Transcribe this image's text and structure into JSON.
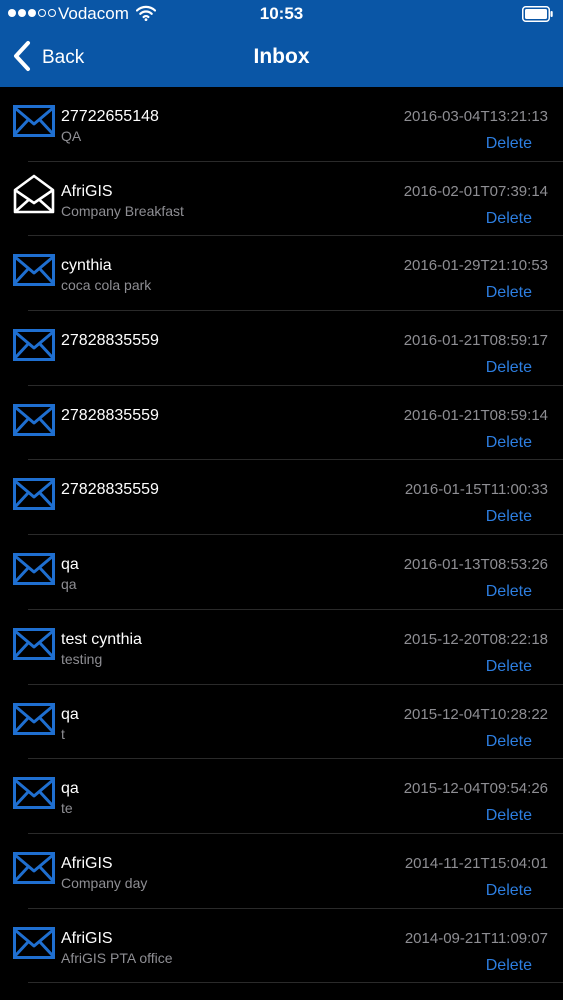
{
  "status_bar": {
    "carrier": "Vodacom",
    "time": "10:53",
    "signal_bars_filled": 3,
    "signal_bars_total": 5
  },
  "nav": {
    "back_label": "Back",
    "title": "Inbox"
  },
  "colors": {
    "nav_background": "#0a56a6",
    "accent": "#2d7ee0",
    "unread_icon": "#1f6fd0",
    "read_icon": "#ffffff"
  },
  "messages": [
    {
      "from": "27722655148",
      "subject": "QA",
      "timestamp": "2016-03-04T13:21:13",
      "delete_label": "Delete",
      "icon": "envelope-closed-icon"
    },
    {
      "from": "AfriGIS",
      "subject": "Company Breakfast",
      "timestamp": "2016-02-01T07:39:14",
      "delete_label": "Delete",
      "icon": "envelope-open-icon"
    },
    {
      "from": "cynthia",
      "subject": "coca cola park",
      "timestamp": "2016-01-29T21:10:53",
      "delete_label": "Delete",
      "icon": "envelope-closed-icon"
    },
    {
      "from": "27828835559",
      "subject": "",
      "timestamp": "2016-01-21T08:59:17",
      "delete_label": "Delete",
      "icon": "envelope-closed-icon"
    },
    {
      "from": "27828835559",
      "subject": "",
      "timestamp": "2016-01-21T08:59:14",
      "delete_label": "Delete",
      "icon": "envelope-closed-icon"
    },
    {
      "from": "27828835559",
      "subject": "",
      "timestamp": "2016-01-15T11:00:33",
      "delete_label": "Delete",
      "icon": "envelope-closed-icon"
    },
    {
      "from": "qa",
      "subject": "qa",
      "timestamp": "2016-01-13T08:53:26",
      "delete_label": "Delete",
      "icon": "envelope-closed-icon"
    },
    {
      "from": "test cynthia",
      "subject": "testing",
      "timestamp": "2015-12-20T08:22:18",
      "delete_label": "Delete",
      "icon": "envelope-closed-icon"
    },
    {
      "from": "qa",
      "subject": "t",
      "timestamp": "2015-12-04T10:28:22",
      "delete_label": "Delete",
      "icon": "envelope-closed-icon"
    },
    {
      "from": "qa",
      "subject": "te",
      "timestamp": "2015-12-04T09:54:26",
      "delete_label": "Delete",
      "icon": "envelope-closed-icon"
    },
    {
      "from": "AfriGIS",
      "subject": "Company day",
      "timestamp": "2014-11-21T15:04:01",
      "delete_label": "Delete",
      "icon": "envelope-closed-icon"
    },
    {
      "from": "AfriGIS",
      "subject": "AfriGIS PTA office",
      "timestamp": "2014-09-21T11:09:07",
      "delete_label": "Delete",
      "icon": "envelope-closed-icon"
    }
  ]
}
